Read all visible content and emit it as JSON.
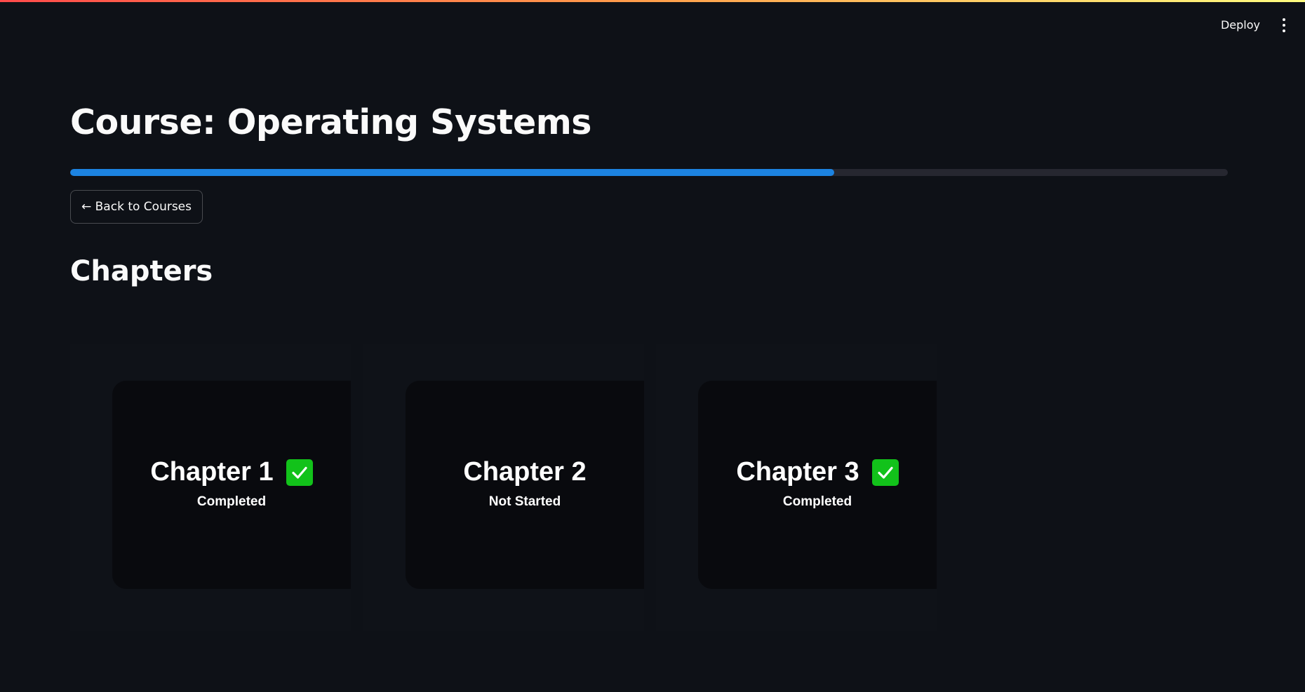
{
  "header": {
    "deploy_label": "Deploy",
    "menu_icon": "kebab-menu-icon",
    "accent_gradient": [
      "#ff4b4b",
      "#fffd80"
    ]
  },
  "main": {
    "title": "Course: Operating Systems",
    "progress": {
      "fraction": 0.66,
      "color": "#1c83e1"
    },
    "back_button_label": "← Back to Courses",
    "section_heading": "Chapters",
    "chapters": [
      {
        "title": "Chapter 1",
        "status": "Completed",
        "completed": true,
        "icon": "check-mark-icon"
      },
      {
        "title": "Chapter 2",
        "status": "Not Started",
        "completed": false
      },
      {
        "title": "Chapter 3",
        "status": "Completed",
        "completed": true,
        "icon": "check-mark-icon"
      }
    ]
  },
  "colors": {
    "background": "#0e1117",
    "card_background": "#090a0e",
    "completed_check": "#12c21a"
  }
}
